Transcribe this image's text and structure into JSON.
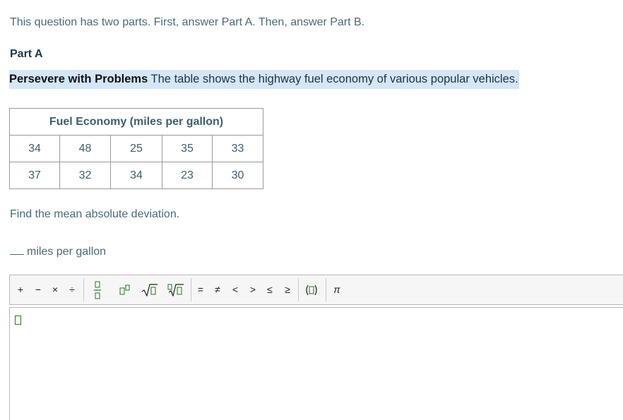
{
  "intro": "This question has two parts. First, answer Part A. Then, answer Part B.",
  "part_title": "Part A",
  "prompt": {
    "bold": "Persevere with Problems",
    "text": " The table shows the highway fuel economy of various popular vehicles."
  },
  "table": {
    "header": "Fuel Economy (miles per gallon)",
    "rows": [
      [
        "34",
        "48",
        "25",
        "35",
        "33"
      ],
      [
        "37",
        "32",
        "34",
        "23",
        "30"
      ]
    ]
  },
  "question": "Find the mean absolute deviation.",
  "answer_unit": "miles per gallon",
  "toolbar": {
    "plus": "+",
    "minus": "−",
    "times": "×",
    "divide": "÷",
    "equals": "=",
    "not_equal": "≠",
    "less": "<",
    "greater": ">",
    "less_equal": "≤",
    "greater_equal": "≥",
    "pi": "π"
  }
}
